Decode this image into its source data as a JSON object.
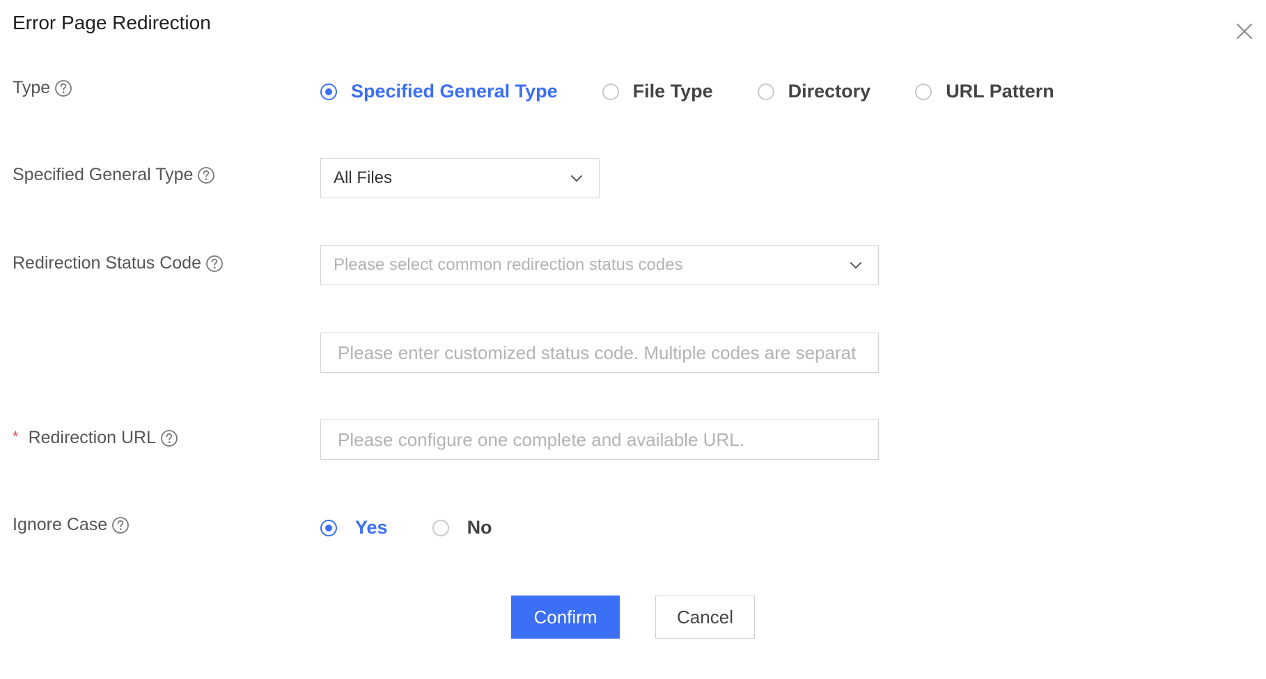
{
  "dialog": {
    "title": "Error Page Redirection",
    "close_icon": "close-icon"
  },
  "type_field": {
    "label": "Type",
    "options": [
      {
        "label": "Specified General Type",
        "selected": true
      },
      {
        "label": "File Type",
        "selected": false
      },
      {
        "label": "Directory",
        "selected": false
      },
      {
        "label": "URL Pattern",
        "selected": false
      }
    ]
  },
  "general_type_field": {
    "label": "Specified General Type",
    "value": "All Files"
  },
  "status_code_field": {
    "label": "Redirection Status Code",
    "select_placeholder": "Please select common redirection status codes",
    "custom_placeholder": "Please enter customized status code. Multiple codes are separat"
  },
  "redirection_url_field": {
    "required_mark": "*",
    "label": "Redirection URL",
    "placeholder": "Please configure one complete and available URL."
  },
  "ignore_case_field": {
    "label": "Ignore Case",
    "options": [
      {
        "label": "Yes",
        "selected": true
      },
      {
        "label": "No",
        "selected": false
      }
    ]
  },
  "actions": {
    "confirm": "Confirm",
    "cancel": "Cancel"
  },
  "colors": {
    "accent": "#3b6ff5",
    "required": "#e34d59",
    "border": "#d4d4d4",
    "placeholder": "#b3b3b3"
  }
}
